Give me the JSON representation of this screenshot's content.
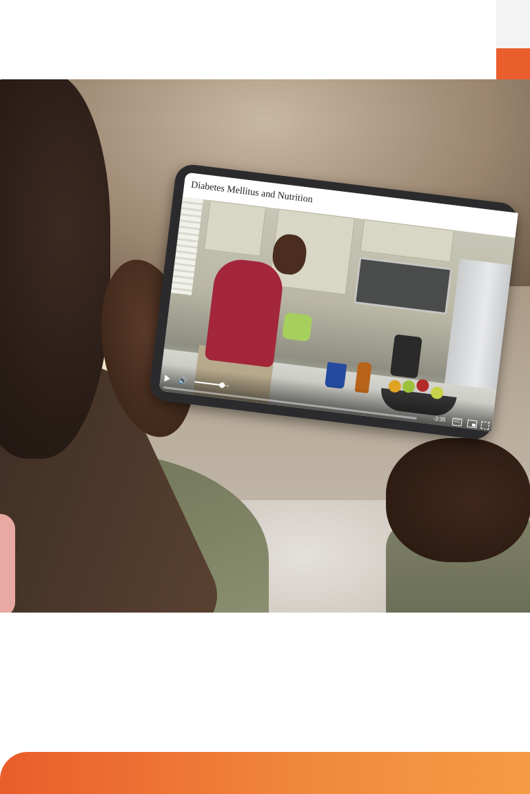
{
  "video": {
    "title": "Diabetes Mellitus and Nutrition",
    "time_remaining": "-3:35",
    "volume_level": 0.8,
    "progress": 0.0,
    "cc_label": "CC"
  },
  "colors": {
    "accent_orange": "#ea5d2c",
    "gradient_end": "#f69b45",
    "tablet_frame": "#2b2b2d"
  },
  "icons": [
    "play-icon",
    "volume-icon",
    "closed-captions-icon",
    "picture-in-picture-icon",
    "fullscreen-icon"
  ]
}
